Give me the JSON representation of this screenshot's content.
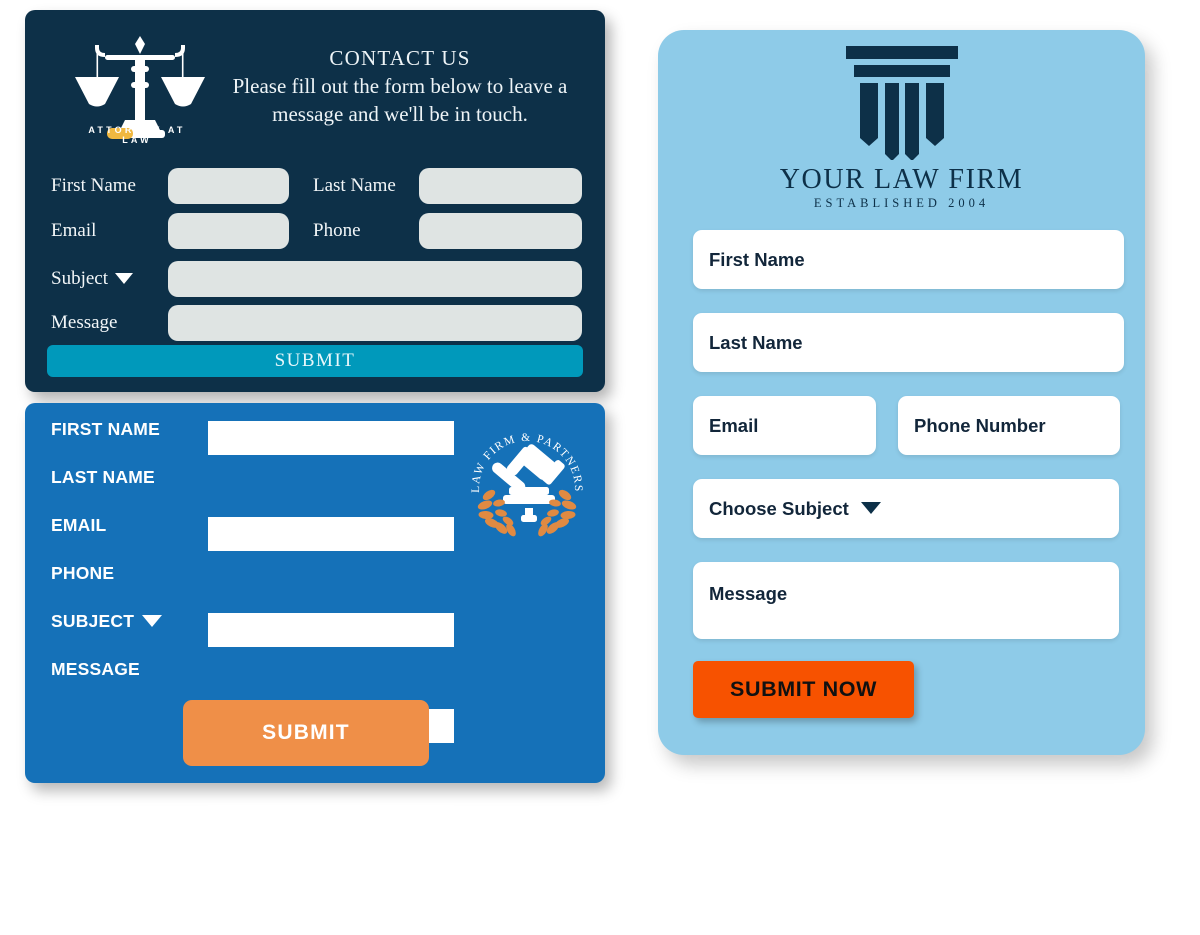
{
  "theme": {
    "navy": "#0d3048",
    "teal": "#0099bb",
    "blue": "#1571b8",
    "light_blue": "#8ecbe8",
    "orange_soft": "#ef8f48",
    "orange_bright": "#f75200",
    "field_gray": "#dfe4e3",
    "white": "#ffffff",
    "gold": "#f0b840"
  },
  "navy_card": {
    "logo": {
      "icon": "scales-of-justice-icon",
      "caption": "ATTORNEY AT LAW"
    },
    "heading": "CONTACT US",
    "subheading_line1": "Please fill out the form below to leave a",
    "subheading_line2": "message and we'll be in touch.",
    "fields": [
      {
        "label": "First Name"
      },
      {
        "label": "Last Name"
      },
      {
        "label": "Email"
      },
      {
        "label": "Phone"
      },
      {
        "label": "Subject",
        "dropdown": true
      },
      {
        "label": "Message"
      }
    ],
    "submit_label": "SUBMIT"
  },
  "blue_card": {
    "badge": {
      "icon": "gavel-laurel-badge-icon",
      "text": "LAW FIRM & PARTNERS"
    },
    "fields": [
      {
        "label": "FIRST NAME"
      },
      {
        "label": "LAST NAME"
      },
      {
        "label": "EMAIL"
      },
      {
        "label": "PHONE"
      },
      {
        "label": "SUBJECT",
        "dropdown": true
      },
      {
        "label": "MESSAGE"
      }
    ],
    "submit_label": "SUBMIT"
  },
  "light_panel": {
    "logo": {
      "icon": "law-pillar-icon"
    },
    "firm_name": "YOUR LAW FIRM",
    "established": "ESTABLISHED 2004",
    "fields": [
      {
        "placeholder": "First Name"
      },
      {
        "placeholder": "Last Name"
      },
      {
        "placeholder": "Email"
      },
      {
        "placeholder": "Phone Number"
      },
      {
        "placeholder": "Choose Subject",
        "dropdown": true
      },
      {
        "placeholder": "Message"
      }
    ],
    "submit_label": "SUBMIT NOW"
  }
}
